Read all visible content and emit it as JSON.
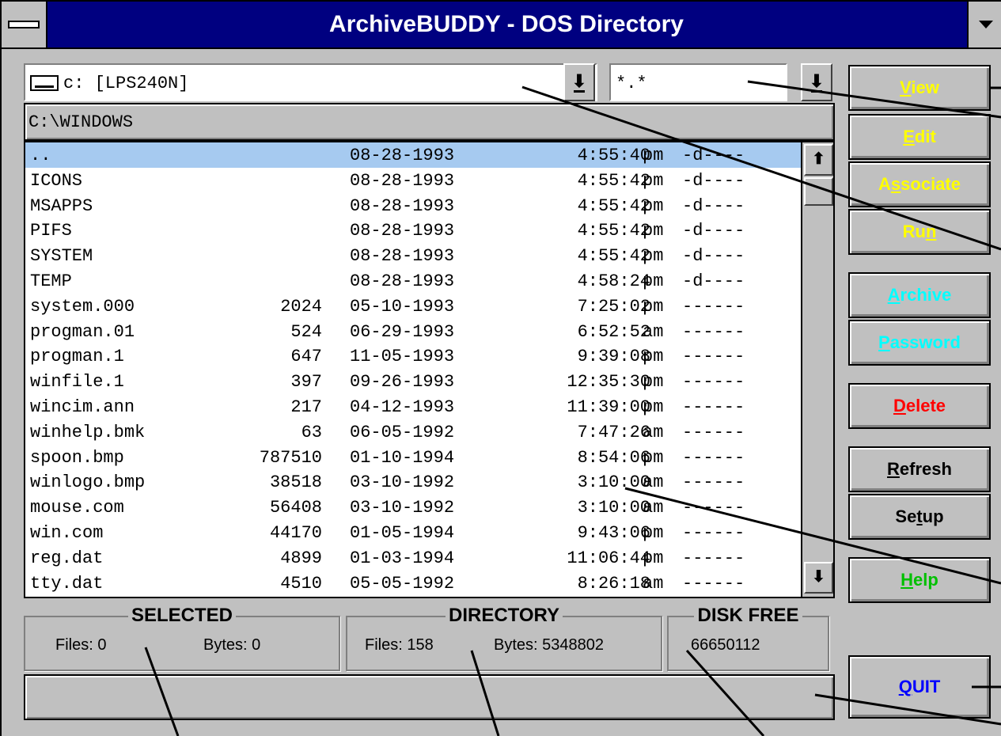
{
  "window": {
    "title": "ArchiveBUDDY - DOS Directory"
  },
  "drive_combo": {
    "value": "c: [LPS240N]"
  },
  "mask_combo": {
    "value": "*.*"
  },
  "dropdown_arrow": "⬇",
  "path": "C:\\WINDOWS",
  "scroll": {
    "up": "⬆",
    "down": "⬇"
  },
  "files": [
    {
      "name": "..",
      "size": "",
      "date": "08-28-1993",
      "time": "4:55:40",
      "ampm": "pm",
      "attr": "-d----",
      "selected": true
    },
    {
      "name": "ICONS",
      "size": "",
      "date": "08-28-1993",
      "time": "4:55:42",
      "ampm": "pm",
      "attr": "-d----"
    },
    {
      "name": "MSAPPS",
      "size": "",
      "date": "08-28-1993",
      "time": "4:55:42",
      "ampm": "pm",
      "attr": "-d----"
    },
    {
      "name": "PIFS",
      "size": "",
      "date": "08-28-1993",
      "time": "4:55:42",
      "ampm": "pm",
      "attr": "-d----"
    },
    {
      "name": "SYSTEM",
      "size": "",
      "date": "08-28-1993",
      "time": "4:55:42",
      "ampm": "pm",
      "attr": "-d----"
    },
    {
      "name": "TEMP",
      "size": "",
      "date": "08-28-1993",
      "time": "4:58:24",
      "ampm": "pm",
      "attr": "-d----"
    },
    {
      "name": "system.000",
      "size": "2024",
      "date": "05-10-1993",
      "time": "7:25:02",
      "ampm": "pm",
      "attr": "------"
    },
    {
      "name": "progman.01",
      "size": "524",
      "date": "06-29-1993",
      "time": "6:52:52",
      "ampm": "am",
      "attr": "------"
    },
    {
      "name": "progman.1",
      "size": "647",
      "date": "11-05-1993",
      "time": "9:39:08",
      "ampm": "pm",
      "attr": "------"
    },
    {
      "name": "winfile.1",
      "size": "397",
      "date": "09-26-1993",
      "time": "12:35:30",
      "ampm": "pm",
      "attr": "------"
    },
    {
      "name": "wincim.ann",
      "size": "217",
      "date": "04-12-1993",
      "time": "11:39:00",
      "ampm": "pm",
      "attr": "------"
    },
    {
      "name": "winhelp.bmk",
      "size": "63",
      "date": "06-05-1992",
      "time": "7:47:26",
      "ampm": "am",
      "attr": "------"
    },
    {
      "name": "spoon.bmp",
      "size": "787510",
      "date": "01-10-1994",
      "time": "8:54:06",
      "ampm": "pm",
      "attr": "------"
    },
    {
      "name": "winlogo.bmp",
      "size": "38518",
      "date": "03-10-1992",
      "time": "3:10:00",
      "ampm": "am",
      "attr": "------"
    },
    {
      "name": "mouse.com",
      "size": "56408",
      "date": "03-10-1992",
      "time": "3:10:00",
      "ampm": "am",
      "attr": "------"
    },
    {
      "name": "win.com",
      "size": "44170",
      "date": "01-05-1994",
      "time": "9:43:06",
      "ampm": "pm",
      "attr": "------"
    },
    {
      "name": "reg.dat",
      "size": "4899",
      "date": "01-03-1994",
      "time": "11:06:44",
      "ampm": "pm",
      "attr": "------"
    },
    {
      "name": "tty.dat",
      "size": "4510",
      "date": "05-05-1992",
      "time": "8:26:18",
      "ampm": "am",
      "attr": "------"
    }
  ],
  "selected": {
    "legend": "SELECTED",
    "files": "Files: 0",
    "bytes": "Bytes: 0"
  },
  "directory": {
    "legend": "DIRECTORY",
    "files": "Files: 158",
    "bytes": "Bytes: 5348802"
  },
  "disk_free": {
    "legend": "DISK FREE",
    "value": "66650112"
  },
  "buttons": {
    "view": {
      "pre": "",
      "ul": "V",
      "post": "iew"
    },
    "edit": {
      "pre": "",
      "ul": "E",
      "post": "dit"
    },
    "associate": {
      "pre": "A",
      "ul": "s",
      "post": "sociate"
    },
    "run": {
      "pre": "Ru",
      "ul": "n",
      "post": ""
    },
    "archive": {
      "pre": "",
      "ul": "A",
      "post": "rchive"
    },
    "password": {
      "pre": "",
      "ul": "P",
      "post": "assword"
    },
    "delete": {
      "pre": "",
      "ul": "D",
      "post": "elete"
    },
    "refresh": {
      "pre": "",
      "ul": "R",
      "post": "efresh"
    },
    "setup": {
      "pre": "Se",
      "ul": "t",
      "post": "up"
    },
    "help": {
      "pre": "",
      "ul": "H",
      "post": "elp"
    },
    "quit": {
      "pre": "",
      "ul": "Q",
      "post": "UIT"
    }
  },
  "colors": {
    "titlebar": "#000080",
    "face": "#c0c0c0",
    "selection": "#a6caf0",
    "yellow": "#ffff00",
    "cyan": "#00ffff",
    "red": "#ff0000",
    "green": "#00c000",
    "blue": "#0000ff"
  }
}
